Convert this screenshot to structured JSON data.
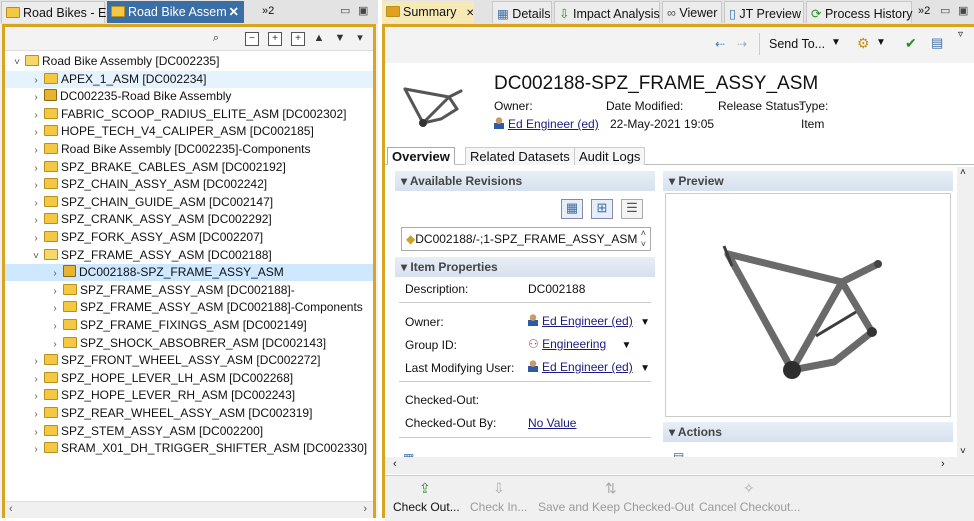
{
  "left_tabs": [
    {
      "label": "Road Bikes - Ed"
    },
    {
      "label": "Road Bike Assem"
    },
    {
      "label": "»2"
    }
  ],
  "tree": [
    {
      "indent": 0,
      "chev": "˅",
      "label": "Road Bike Assembly [DC002235]",
      "icon": "folder-open"
    },
    {
      "indent": 1,
      "chev": "›",
      "label": "APEX_1_ASM [DC002234]",
      "icon": "folder",
      "hover": true
    },
    {
      "indent": 1,
      "chev": "›",
      "label": "DC002235-Road Bike Assembly",
      "icon": "item"
    },
    {
      "indent": 1,
      "chev": "›",
      "label": "FABRIC_SCOOP_RADIUS_ELITE_ASM [DC002302]",
      "icon": "folder"
    },
    {
      "indent": 1,
      "chev": "›",
      "label": "HOPE_TECH_V4_CALIPER_ASM [DC002185]",
      "icon": "folder"
    },
    {
      "indent": 1,
      "chev": "›",
      "label": "Road Bike Assembly [DC002235]-Components",
      "icon": "folder"
    },
    {
      "indent": 1,
      "chev": "›",
      "label": "SPZ_BRAKE_CABLES_ASM [DC002192]",
      "icon": "folder"
    },
    {
      "indent": 1,
      "chev": "›",
      "label": "SPZ_CHAIN_ASSY_ASM [DC002242]",
      "icon": "folder"
    },
    {
      "indent": 1,
      "chev": "›",
      "label": "SPZ_CHAIN_GUIDE_ASM [DC002147]",
      "icon": "folder"
    },
    {
      "indent": 1,
      "chev": "›",
      "label": "SPZ_CRANK_ASSY_ASM [DC002292]",
      "icon": "folder"
    },
    {
      "indent": 1,
      "chev": "›",
      "label": "SPZ_FORK_ASSY_ASM [DC002207]",
      "icon": "folder"
    },
    {
      "indent": 1,
      "chev": "˅",
      "label": "SPZ_FRAME_ASSY_ASM [DC002188]",
      "icon": "folder-open"
    },
    {
      "indent": 2,
      "chev": "›",
      "label": "DC002188-SPZ_FRAME_ASSY_ASM",
      "icon": "item",
      "selected": true
    },
    {
      "indent": 2,
      "chev": "›",
      "label": "SPZ_FRAME_ASSY_ASM [DC002188]-",
      "icon": "folder"
    },
    {
      "indent": 2,
      "chev": "›",
      "label": "SPZ_FRAME_ASSY_ASM [DC002188]-Components",
      "icon": "folder"
    },
    {
      "indent": 2,
      "chev": "›",
      "label": "SPZ_FRAME_FIXINGS_ASM [DC002149]",
      "icon": "folder"
    },
    {
      "indent": 2,
      "chev": "›",
      "label": "SPZ_SHOCK_ABSOBRER_ASM [DC002143]",
      "icon": "folder"
    },
    {
      "indent": 1,
      "chev": "›",
      "label": "SPZ_FRONT_WHEEL_ASSY_ASM [DC002272]",
      "icon": "folder"
    },
    {
      "indent": 1,
      "chev": "›",
      "label": "SPZ_HOPE_LEVER_LH_ASM [DC002268]",
      "icon": "folder"
    },
    {
      "indent": 1,
      "chev": "›",
      "label": "SPZ_HOPE_LEVER_RH_ASM [DC002243]",
      "icon": "folder"
    },
    {
      "indent": 1,
      "chev": "›",
      "label": "SPZ_REAR_WHEEL_ASSY_ASM [DC002319]",
      "icon": "folder"
    },
    {
      "indent": 1,
      "chev": "›",
      "label": "SPZ_STEM_ASSY_ASM [DC002200]",
      "icon": "folder"
    },
    {
      "indent": 1,
      "chev": "›",
      "label": "SRAM_X01_DH_TRIGGER_SHIFTER_ASM [DC002330]",
      "icon": "folder"
    }
  ],
  "right_tabs": [
    {
      "label": "Summary"
    },
    {
      "label": "Details"
    },
    {
      "label": "Impact Analysis"
    },
    {
      "label": "Viewer"
    },
    {
      "label": "JT Preview"
    },
    {
      "label": "Process History"
    },
    {
      "label": "»2"
    }
  ],
  "toolbar": {
    "send_to": "Send To..."
  },
  "header": {
    "title": "DC002188-SPZ_FRAME_ASSY_ASM",
    "owner_label": "Owner:",
    "owner_value": "Ed Engineer (ed)",
    "date_label": "Date Modified:",
    "date_value": "22-May-2021 19:05",
    "release_label": "Release Status:",
    "type_label": "Type:",
    "type_value": "Item"
  },
  "subtabs": [
    {
      "label": "Overview"
    },
    {
      "label": "Related Datasets"
    },
    {
      "label": "Audit Logs"
    }
  ],
  "revisions": {
    "section": "Available Revisions",
    "value": "DC002188/-;1-SPZ_FRAME_ASSY_ASM"
  },
  "item_props": {
    "section": "Item Properties",
    "description_label": "Description:",
    "description_value": "DC002188",
    "owner_label": "Owner:",
    "owner_value": "Ed Engineer (ed)",
    "group_label": "Group ID:",
    "group_value": "Engineering",
    "lmu_label": "Last Modifying User:",
    "lmu_value": "Ed Engineer (ed)",
    "checked_out_label": "Checked-Out:",
    "checked_out_by_label": "Checked-Out By:",
    "checked_out_by_value": "No Value"
  },
  "preview": {
    "section": "Preview"
  },
  "actions": {
    "section": "Actions"
  },
  "bottom_actions": [
    {
      "label": "Check Out...",
      "enabled": true
    },
    {
      "label": "Check In...",
      "enabled": false
    },
    {
      "label": "Save and Keep Checked-Out",
      "enabled": false
    },
    {
      "label": "Cancel Checkout...",
      "enabled": false
    }
  ]
}
